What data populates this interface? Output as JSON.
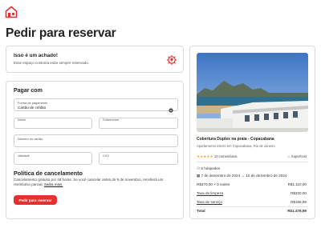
{
  "page": {
    "title": "Pedir para reservar"
  },
  "colors": {
    "accent": "#e4312f",
    "border": "#dcdcdc"
  },
  "notice": {
    "title": "Isso é um achado!",
    "subtitle": "Esse espaço costuma estar sempre reservado.",
    "icon": "diamond-icon"
  },
  "payment": {
    "title": "Pagar com",
    "method": {
      "label": "Forma de pagamento",
      "value": "Cartão de crédito"
    },
    "first_name": {
      "label": "Nome"
    },
    "last_name": {
      "label": "Sobrenome"
    },
    "card_number": {
      "label": "Número do cartão"
    },
    "expiry": {
      "label": "Validade"
    },
    "cvv": {
      "label": "CVV"
    }
  },
  "policy": {
    "title": "Política de cancelamento",
    "text": "Cancelamento gratuito por 48 horas. Se você cancelar antes de 9 de novembro, receberá um reembolso parcial.",
    "link": "Saiba mais."
  },
  "reserve_button": {
    "label": "Pedir para reservar"
  },
  "listing": {
    "name": "Cobertura Duplex na praia - Copacabana",
    "location": "Apartamento inteiro em Copacabana, Rio de Janeiro",
    "rating_count": "10 comentários",
    "stars": 5,
    "badge": "Superhost",
    "guests": "5 hóspedes",
    "checkin": "7 de dezembro de 2024",
    "arrow": "→",
    "checkout": "10 de dezembro de 2024",
    "prices": [
      {
        "label": "R$370,00 × 3 noites",
        "value": "R$1.110,00"
      },
      {
        "label": "Taxa de limpeza",
        "value": "R$200,00"
      },
      {
        "label": "Taxa de serviço",
        "value": "R$168,99"
      }
    ],
    "total": {
      "label": "Total",
      "value": "R$1.478,99"
    }
  }
}
